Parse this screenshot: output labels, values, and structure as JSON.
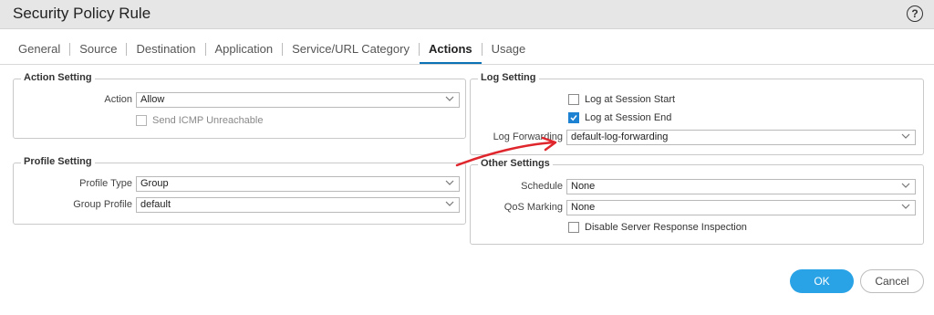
{
  "dialog": {
    "title": "Security Policy Rule",
    "help_glyph": "?"
  },
  "tabs": [
    {
      "label": "General"
    },
    {
      "label": "Source"
    },
    {
      "label": "Destination"
    },
    {
      "label": "Application"
    },
    {
      "label": "Service/URL Category"
    },
    {
      "label": "Actions",
      "active": true
    },
    {
      "label": "Usage"
    }
  ],
  "action_setting": {
    "legend": "Action Setting",
    "action_label": "Action",
    "action_value": "Allow",
    "send_icmp_label": "Send ICMP Unreachable",
    "send_icmp_checked": false,
    "send_icmp_disabled": true
  },
  "profile_setting": {
    "legend": "Profile Setting",
    "profile_type_label": "Profile Type",
    "profile_type_value": "Group",
    "group_profile_label": "Group Profile",
    "group_profile_value": "default"
  },
  "log_setting": {
    "legend": "Log Setting",
    "log_start_label": "Log at Session Start",
    "log_start_checked": false,
    "log_end_label": "Log at Session End",
    "log_end_checked": true,
    "log_forwarding_label": "Log Forwarding",
    "log_forwarding_value": "default-log-forwarding"
  },
  "other_settings": {
    "legend": "Other Settings",
    "schedule_label": "Schedule",
    "schedule_value": "None",
    "qos_label": "QoS Marking",
    "qos_value": "None",
    "disable_inspection_label": "Disable Server Response Inspection",
    "disable_inspection_checked": false
  },
  "footer": {
    "ok_label": "OK",
    "cancel_label": "Cancel"
  },
  "colors": {
    "accent": "#29a3e6",
    "tab_underline": "#0c72b6",
    "annotation_arrow": "#e0262d"
  },
  "icons": [
    "help-icon",
    "chevron-down-icon",
    "checkmark-icon",
    "annotation-arrow"
  ]
}
